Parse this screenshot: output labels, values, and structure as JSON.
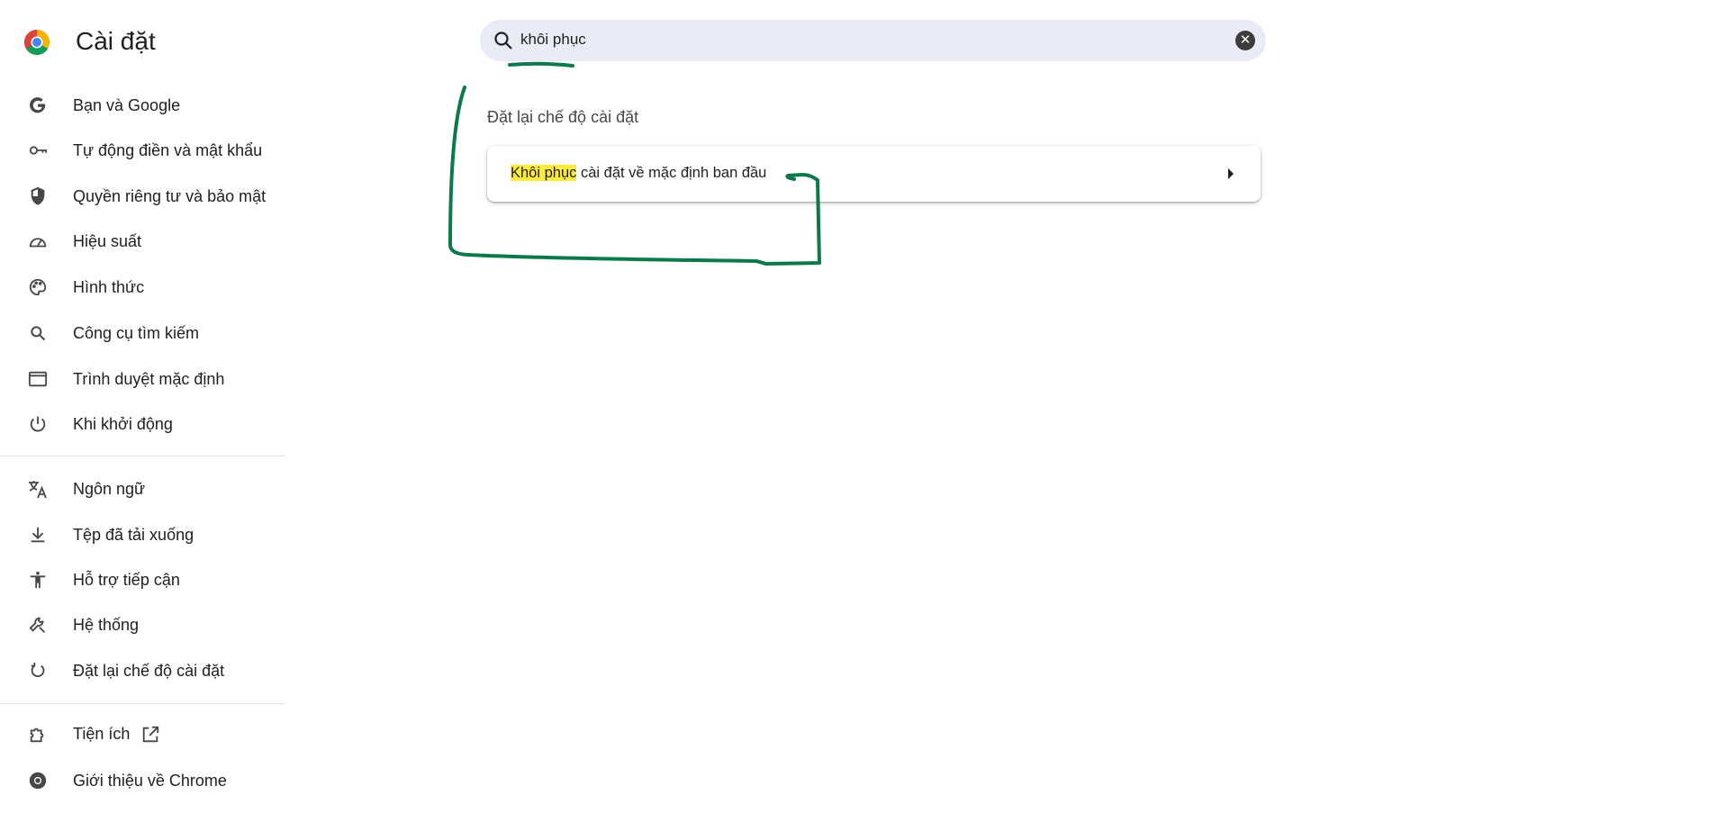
{
  "header": {
    "title": "Cài đặt",
    "logo": "chrome-logo"
  },
  "search": {
    "value": "khôi phục",
    "icon": "search-icon",
    "clear_icon": "close-icon"
  },
  "sidebar": {
    "items": [
      {
        "label": "Bạn và Google",
        "icon": "google-icon"
      },
      {
        "label": "Tự động điền và mật khẩu",
        "icon": "key-icon"
      },
      {
        "label": "Quyền riêng tư và bảo mật",
        "icon": "shield-icon"
      },
      {
        "label": "Hiệu suất",
        "icon": "speedometer-icon"
      },
      {
        "label": "Hình thức",
        "icon": "palette-icon"
      },
      {
        "label": "Công cụ tìm kiếm",
        "icon": "search-icon"
      },
      {
        "label": "Trình duyệt mặc định",
        "icon": "browser-window-icon"
      },
      {
        "label": "Khi khởi động",
        "icon": "power-icon"
      },
      {
        "label": "Ngôn ngữ",
        "icon": "translate-icon"
      },
      {
        "label": "Tệp đã tải xuống",
        "icon": "download-icon"
      },
      {
        "label": "Hỗ trợ tiếp cận",
        "icon": "accessibility-icon"
      },
      {
        "label": "Hệ thống",
        "icon": "wrench-icon"
      },
      {
        "label": "Đặt lại chế độ cài đặt",
        "icon": "reset-icon"
      },
      {
        "label": "Tiện ích",
        "icon": "extension-icon"
      },
      {
        "label": "Giới thiệu về Chrome",
        "icon": "chrome-icon"
      }
    ]
  },
  "main": {
    "section_title": "Đặt lại chế độ cài đặt",
    "result": {
      "highlight": "Khôi phục",
      "rest": " cài đặt về mặc định ban đầu"
    }
  },
  "colors": {
    "annotation": "#0b7a4b",
    "highlight": "#ffeb3b",
    "search_bg": "#e9ecf7"
  }
}
